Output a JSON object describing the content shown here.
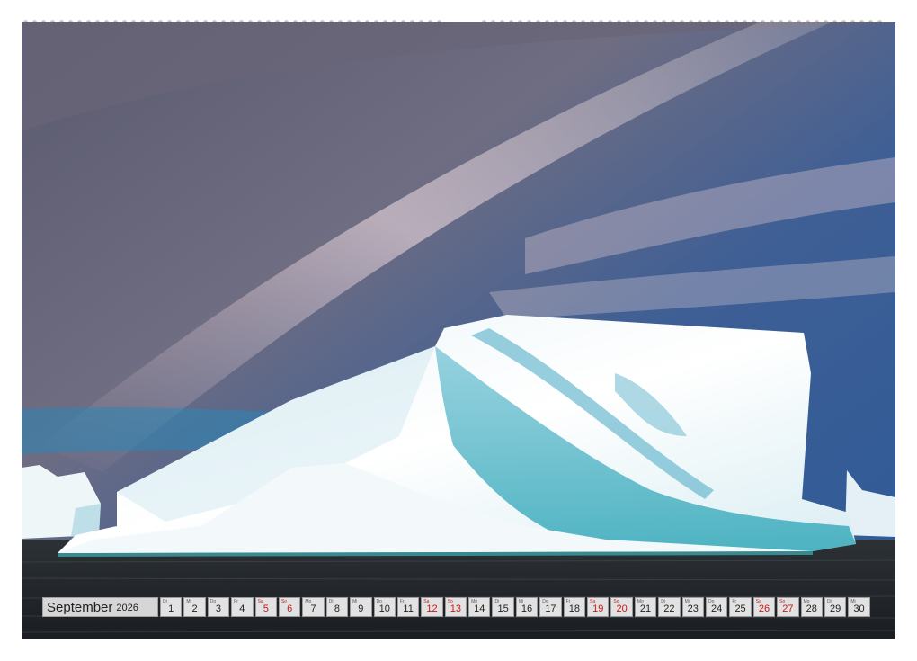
{
  "calendar": {
    "month": "September",
    "year": "2026",
    "days": [
      {
        "n": "1",
        "wd": "Di",
        "weekend": false
      },
      {
        "n": "2",
        "wd": "Mi",
        "weekend": false
      },
      {
        "n": "3",
        "wd": "Do",
        "weekend": false
      },
      {
        "n": "4",
        "wd": "Fr",
        "weekend": false
      },
      {
        "n": "5",
        "wd": "Sa",
        "weekend": true
      },
      {
        "n": "6",
        "wd": "So",
        "weekend": true
      },
      {
        "n": "7",
        "wd": "Mo",
        "weekend": false
      },
      {
        "n": "8",
        "wd": "Di",
        "weekend": false
      },
      {
        "n": "9",
        "wd": "Mi",
        "weekend": false
      },
      {
        "n": "10",
        "wd": "Do",
        "weekend": false
      },
      {
        "n": "11",
        "wd": "Fr",
        "weekend": false
      },
      {
        "n": "12",
        "wd": "Sa",
        "weekend": true
      },
      {
        "n": "13",
        "wd": "So",
        "weekend": true
      },
      {
        "n": "14",
        "wd": "Mo",
        "weekend": false
      },
      {
        "n": "15",
        "wd": "Di",
        "weekend": false
      },
      {
        "n": "16",
        "wd": "Mi",
        "weekend": false
      },
      {
        "n": "17",
        "wd": "Do",
        "weekend": false
      },
      {
        "n": "18",
        "wd": "Fr",
        "weekend": false
      },
      {
        "n": "19",
        "wd": "Sa",
        "weekend": true
      },
      {
        "n": "20",
        "wd": "So",
        "weekend": true
      },
      {
        "n": "21",
        "wd": "Mo",
        "weekend": false
      },
      {
        "n": "22",
        "wd": "Di",
        "weekend": false
      },
      {
        "n": "23",
        "wd": "Mi",
        "weekend": false
      },
      {
        "n": "24",
        "wd": "Do",
        "weekend": false
      },
      {
        "n": "25",
        "wd": "Fr",
        "weekend": false
      },
      {
        "n": "26",
        "wd": "Sa",
        "weekend": true
      },
      {
        "n": "27",
        "wd": "So",
        "weekend": true
      },
      {
        "n": "28",
        "wd": "Mo",
        "weekend": false
      },
      {
        "n": "29",
        "wd": "Di",
        "weekend": false
      },
      {
        "n": "30",
        "wd": "Mi",
        "weekend": false
      }
    ]
  },
  "colors": {
    "weekend": "#c81818",
    "cell_bg": "#e2e2e2",
    "border": "#9a9a9a"
  }
}
